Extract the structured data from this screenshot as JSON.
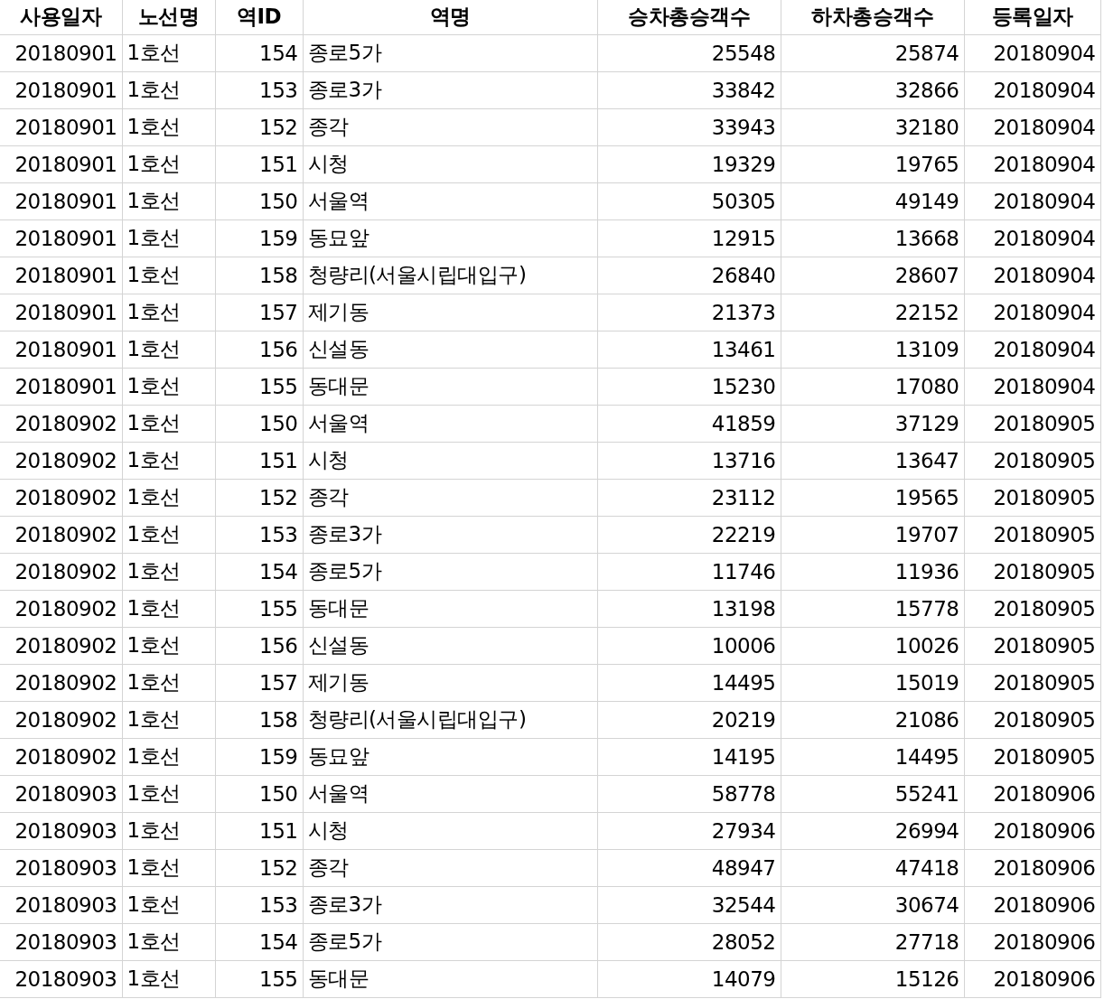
{
  "table": {
    "columns": [
      {
        "label": "사용일자",
        "kind": "number"
      },
      {
        "label": "노선명",
        "kind": "text"
      },
      {
        "label": "역ID",
        "kind": "number"
      },
      {
        "label": "역명",
        "kind": "text"
      },
      {
        "label": "승차총승객수",
        "kind": "number"
      },
      {
        "label": "하차총승객수",
        "kind": "number"
      },
      {
        "label": "등록일자",
        "kind": "number"
      }
    ],
    "rows": [
      [
        "20180901",
        "1호선",
        "154",
        "종로5가",
        "25548",
        "25874",
        "20180904"
      ],
      [
        "20180901",
        "1호선",
        "153",
        "종로3가",
        "33842",
        "32866",
        "20180904"
      ],
      [
        "20180901",
        "1호선",
        "152",
        "종각",
        "33943",
        "32180",
        "20180904"
      ],
      [
        "20180901",
        "1호선",
        "151",
        "시청",
        "19329",
        "19765",
        "20180904"
      ],
      [
        "20180901",
        "1호선",
        "150",
        "서울역",
        "50305",
        "49149",
        "20180904"
      ],
      [
        "20180901",
        "1호선",
        "159",
        "동묘앞",
        "12915",
        "13668",
        "20180904"
      ],
      [
        "20180901",
        "1호선",
        "158",
        "청량리(서울시립대입구)",
        "26840",
        "28607",
        "20180904"
      ],
      [
        "20180901",
        "1호선",
        "157",
        "제기동",
        "21373",
        "22152",
        "20180904"
      ],
      [
        "20180901",
        "1호선",
        "156",
        "신설동",
        "13461",
        "13109",
        "20180904"
      ],
      [
        "20180901",
        "1호선",
        "155",
        "동대문",
        "15230",
        "17080",
        "20180904"
      ],
      [
        "20180902",
        "1호선",
        "150",
        "서울역",
        "41859",
        "37129",
        "20180905"
      ],
      [
        "20180902",
        "1호선",
        "151",
        "시청",
        "13716",
        "13647",
        "20180905"
      ],
      [
        "20180902",
        "1호선",
        "152",
        "종각",
        "23112",
        "19565",
        "20180905"
      ],
      [
        "20180902",
        "1호선",
        "153",
        "종로3가",
        "22219",
        "19707",
        "20180905"
      ],
      [
        "20180902",
        "1호선",
        "154",
        "종로5가",
        "11746",
        "11936",
        "20180905"
      ],
      [
        "20180902",
        "1호선",
        "155",
        "동대문",
        "13198",
        "15778",
        "20180905"
      ],
      [
        "20180902",
        "1호선",
        "156",
        "신설동",
        "10006",
        "10026",
        "20180905"
      ],
      [
        "20180902",
        "1호선",
        "157",
        "제기동",
        "14495",
        "15019",
        "20180905"
      ],
      [
        "20180902",
        "1호선",
        "158",
        "청량리(서울시립대입구)",
        "20219",
        "21086",
        "20180905"
      ],
      [
        "20180902",
        "1호선",
        "159",
        "동묘앞",
        "14195",
        "14495",
        "20180905"
      ],
      [
        "20180903",
        "1호선",
        "150",
        "서울역",
        "58778",
        "55241",
        "20180906"
      ],
      [
        "20180903",
        "1호선",
        "151",
        "시청",
        "27934",
        "26994",
        "20180906"
      ],
      [
        "20180903",
        "1호선",
        "152",
        "종각",
        "48947",
        "47418",
        "20180906"
      ],
      [
        "20180903",
        "1호선",
        "153",
        "종로3가",
        "32544",
        "30674",
        "20180906"
      ],
      [
        "20180903",
        "1호선",
        "154",
        "종로5가",
        "28052",
        "27718",
        "20180906"
      ],
      [
        "20180903",
        "1호선",
        "155",
        "동대문",
        "14079",
        "15126",
        "20180906"
      ]
    ]
  }
}
